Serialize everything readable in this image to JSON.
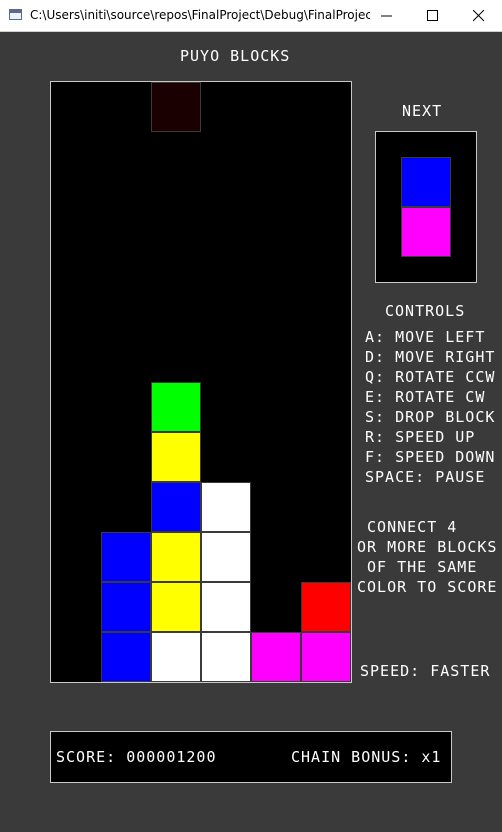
{
  "window": {
    "title": "C:\\Users\\initi\\source\\repos\\FinalProject\\Debug\\FinalProject...."
  },
  "game": {
    "title": "PUYO BLOCKS",
    "next_label": "NEXT",
    "controls_title": "CONTROLS",
    "controls": [
      "A: MOVE LEFT",
      "D: MOVE RIGHT",
      "Q: ROTATE CCW",
      "E: ROTATE CW",
      "S: DROP BLOCK",
      "R: SPEED UP",
      "F: SPEED DOWN",
      "SPACE: PAUSE"
    ],
    "instructions": " CONNECT 4\nOR MORE BLOCKS\n OF THE SAME\nCOLOR TO SCORE",
    "speed_text": "SPEED: FASTER",
    "score_text": "SCORE: 000001200",
    "chain_bonus_text": "CHAIN BONUS: x1"
  },
  "board": {
    "columns": 6,
    "rows": 12,
    "cells": [
      {
        "col": 2,
        "row": 0,
        "color": "#1a0000"
      },
      {
        "col": 2,
        "row": 6,
        "color": "#00ff00"
      },
      {
        "col": 2,
        "row": 7,
        "color": "#ffff00"
      },
      {
        "col": 2,
        "row": 8,
        "color": "#0000ff"
      },
      {
        "col": 3,
        "row": 8,
        "color": "#ffffff"
      },
      {
        "col": 1,
        "row": 9,
        "color": "#0000ff"
      },
      {
        "col": 2,
        "row": 9,
        "color": "#ffff00"
      },
      {
        "col": 3,
        "row": 9,
        "color": "#ffffff"
      },
      {
        "col": 1,
        "row": 10,
        "color": "#0000ff"
      },
      {
        "col": 2,
        "row": 10,
        "color": "#ffff00"
      },
      {
        "col": 3,
        "row": 10,
        "color": "#ffffff"
      },
      {
        "col": 5,
        "row": 10,
        "color": "#ff0000"
      },
      {
        "col": 1,
        "row": 11,
        "color": "#0000ff"
      },
      {
        "col": 2,
        "row": 11,
        "color": "#ffffff"
      },
      {
        "col": 3,
        "row": 11,
        "color": "#ffffff"
      },
      {
        "col": 4,
        "row": 11,
        "color": "#ff00ff"
      },
      {
        "col": 5,
        "row": 11,
        "color": "#ff00ff"
      }
    ]
  },
  "next_piece": {
    "colors": [
      "#0000ff",
      "#ff00ff"
    ]
  }
}
